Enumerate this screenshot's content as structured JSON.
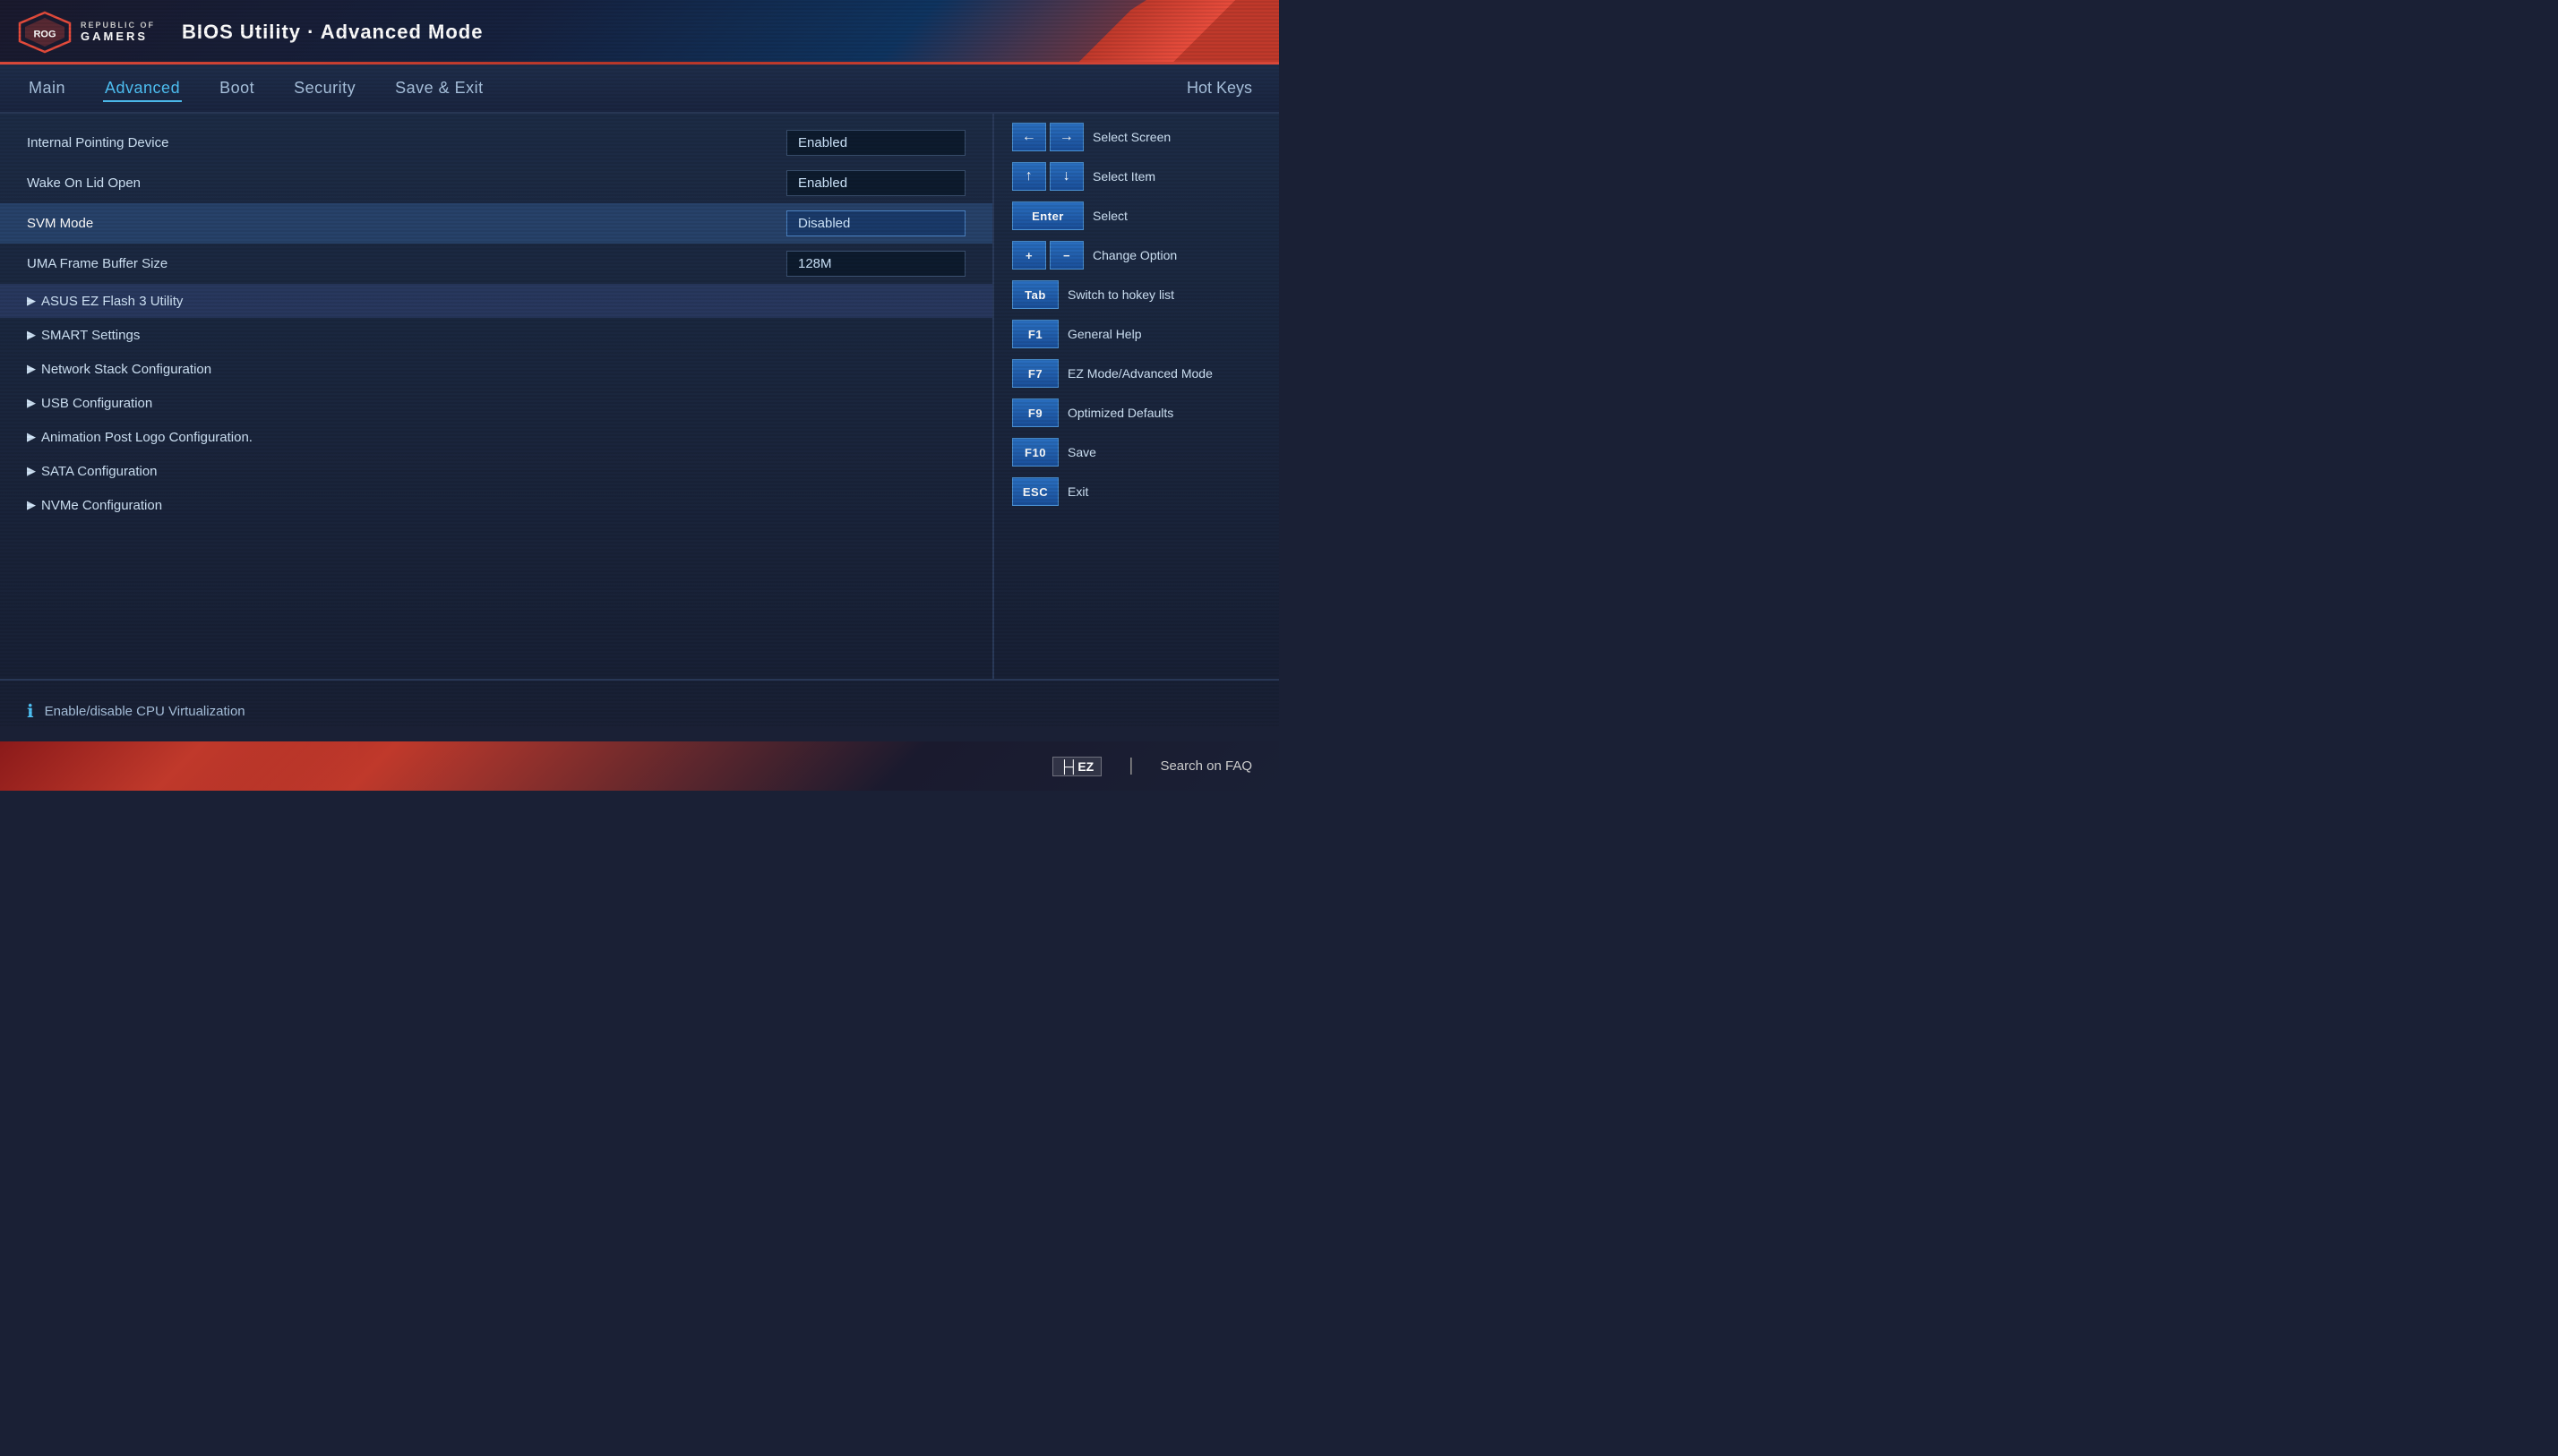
{
  "header": {
    "title": "BIOS Utility · Advanced Mode",
    "logo": {
      "republic": "REPUBLIC OF",
      "gamers": "GAMERS"
    }
  },
  "nav": {
    "tabs": [
      {
        "id": "main",
        "label": "Main",
        "active": false
      },
      {
        "id": "advanced",
        "label": "Advanced",
        "active": true
      },
      {
        "id": "boot",
        "label": "Boot",
        "active": false
      },
      {
        "id": "security",
        "label": "Security",
        "active": false
      },
      {
        "id": "save-exit",
        "label": "Save & Exit",
        "active": false
      }
    ],
    "hot_keys_label": "Hot Keys"
  },
  "settings": {
    "rows": [
      {
        "id": "internal-pointing-device",
        "label": "Internal Pointing Device",
        "value": "Enabled",
        "type": "value",
        "selected": false
      },
      {
        "id": "wake-on-lid-open",
        "label": "Wake On Lid Open",
        "value": "Enabled",
        "type": "value",
        "selected": false
      },
      {
        "id": "svm-mode",
        "label": "SVM Mode",
        "value": "Disabled",
        "type": "value",
        "selected": true
      },
      {
        "id": "uma-frame-buffer-size",
        "label": "UMA Frame Buffer Size",
        "value": "128M",
        "type": "value",
        "selected": false
      }
    ],
    "submenus": [
      {
        "id": "asus-ez-flash",
        "label": "ASUS EZ Flash 3 Utility",
        "active_hover": true
      },
      {
        "id": "smart-settings",
        "label": "SMART Settings",
        "active_hover": false
      },
      {
        "id": "network-stack",
        "label": "Network Stack Configuration",
        "active_hover": false
      },
      {
        "id": "usb-config",
        "label": "USB Configuration",
        "active_hover": false
      },
      {
        "id": "animation-post-logo",
        "label": "Animation Post Logo Configuration.",
        "active_hover": false
      },
      {
        "id": "sata-config",
        "label": "SATA Configuration",
        "active_hover": false
      },
      {
        "id": "nvme-config",
        "label": "NVMe Configuration",
        "active_hover": false
      }
    ]
  },
  "hotkeys": {
    "title": "Hot Keys",
    "items": [
      {
        "id": "select-screen",
        "keys": [
          "←",
          "→"
        ],
        "description": "Select Screen",
        "pair": true
      },
      {
        "id": "select-item",
        "keys": [
          "↑",
          "↓"
        ],
        "description": "Select Item",
        "pair": true
      },
      {
        "id": "select",
        "keys": [
          "Enter"
        ],
        "description": "Select",
        "pair": false
      },
      {
        "id": "change-option",
        "keys": [
          "+",
          "−"
        ],
        "description": "Change Option",
        "pair": true
      },
      {
        "id": "switch-hotkey",
        "keys": [
          "Tab"
        ],
        "description": "Switch to hokey list",
        "pair": false
      },
      {
        "id": "general-help",
        "keys": [
          "F1"
        ],
        "description": "General Help",
        "pair": false
      },
      {
        "id": "ez-mode",
        "keys": [
          "F7"
        ],
        "description": "EZ Mode/Advanced Mode",
        "pair": false
      },
      {
        "id": "optimized-defaults",
        "keys": [
          "F9"
        ],
        "description": "Optimized Defaults",
        "pair": false
      },
      {
        "id": "save",
        "keys": [
          "F10"
        ],
        "description": "Save",
        "pair": false
      },
      {
        "id": "exit",
        "keys": [
          "ESC"
        ],
        "description": "Exit",
        "pair": false
      }
    ]
  },
  "bottom_info": {
    "icon": "ℹ",
    "text": "Enable/disable CPU Virtualization"
  },
  "footer": {
    "items": [
      {
        "id": "ez-mode-footer",
        "key": "├┤EZ",
        "label": ""
      },
      {
        "id": "search-faq",
        "key": "|",
        "label": "Search on FAQ"
      }
    ],
    "ez_key": "├┤EZ",
    "divider": "|",
    "search_label": "Search on FAQ"
  }
}
